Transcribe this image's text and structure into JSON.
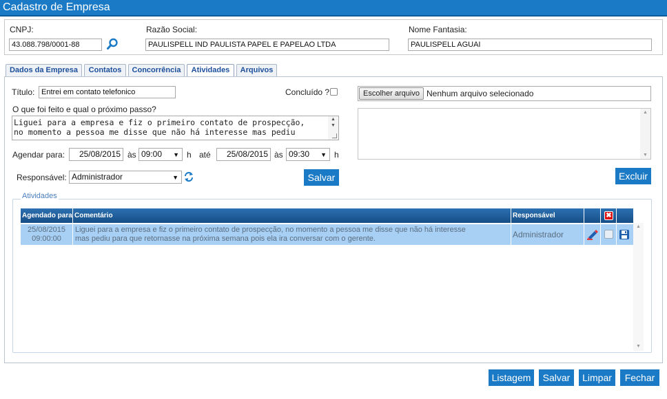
{
  "window": {
    "title": "Cadastro de Empresa"
  },
  "header": {
    "cnpj_label": "CNPJ:",
    "cnpj_value": "43.088.798/0001-88",
    "razao_label": "Razão Social:",
    "razao_value": "PAULISPELL IND PAULISTA PAPEL E PAPELAO LTDA",
    "fantasia_label": "Nome Fantasia:",
    "fantasia_value": "PAULISPELL AGUAI"
  },
  "tabs": [
    {
      "label": "Dados da Empresa"
    },
    {
      "label": "Contatos"
    },
    {
      "label": "Concorrência"
    },
    {
      "label": "Atividades"
    },
    {
      "label": "Arquivos"
    }
  ],
  "form": {
    "titulo_label": "Título:",
    "titulo_value": "Entrei em contato telefonico",
    "concluido_label": "Concluído ?",
    "passo_label": "O que foi feito e qual o próximo passo?",
    "passo_line1": "Liguei para a empresa e fiz o primeiro contato de prospecção,",
    "passo_line2": "no momento a pessoa me disse que não há interesse mas pediu",
    "agendar_label": "Agendar para:",
    "date_from": "25/08/2015",
    "as1": "às",
    "time_from": "09:00",
    "h1": "h",
    "ate": "até",
    "date_to": "25/08/2015",
    "as2": "às",
    "time_to": "09:30",
    "h2": "h",
    "responsavel_label": "Responsável:",
    "responsavel_value": "Administrador",
    "salvar_label": "Salvar",
    "file_button": "Escolher arquivo",
    "file_status": "Nenhum arquivo selecionado",
    "excluir_label": "Excluir"
  },
  "activities": {
    "legend": "Atividades",
    "columns": [
      "Agendado para",
      "Comentário",
      "Responsável"
    ],
    "rows": [
      {
        "date": "25/08/2015",
        "time": "09:00:00",
        "comment_line1": "Liguei para a empresa e fiz o primeiro contato de prospecção, no momento a pessoa me disse que não há interesse",
        "comment_line2": "mas pediu para que retornasse na próxima semana pois ela ira conversar com o gerente.",
        "responsavel": "Administrador"
      }
    ]
  },
  "footer": {
    "listagem": "Listagem",
    "salvar": "Salvar",
    "limpar": "Limpar",
    "fechar": "Fechar"
  },
  "colors": {
    "accent": "#1a7ac6",
    "row_selected": "#a7d0f4",
    "header_dark": "#164e86"
  }
}
